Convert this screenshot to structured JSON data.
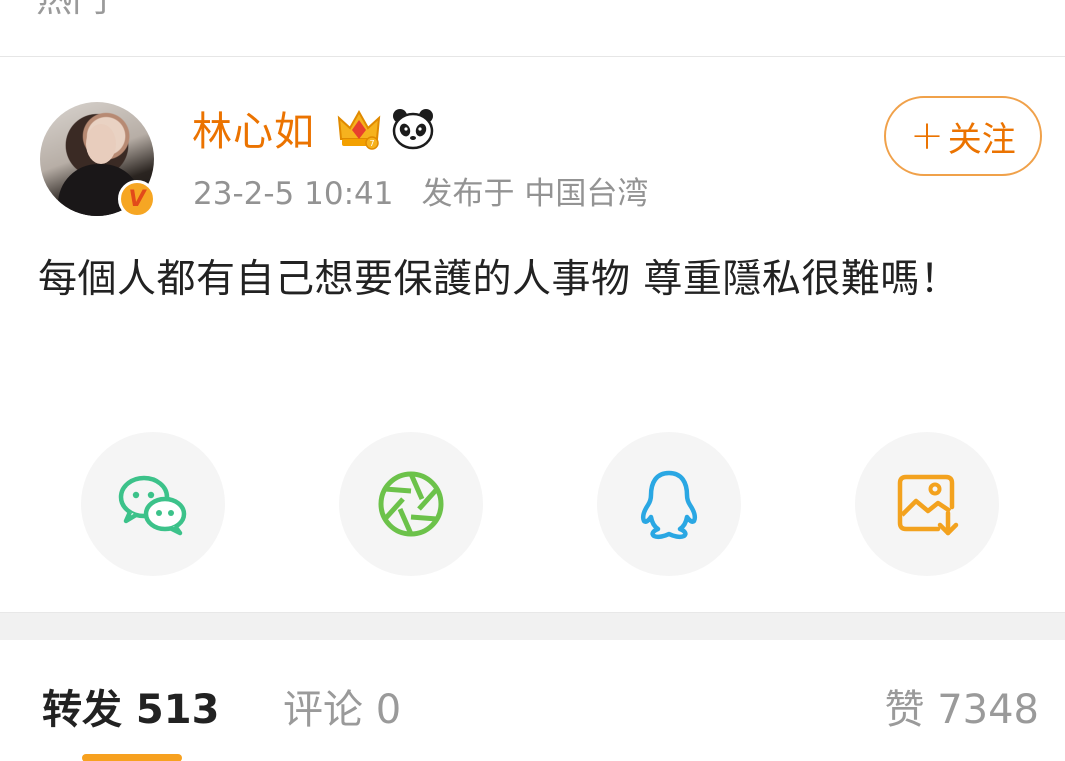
{
  "header": {
    "tab_label": "热门"
  },
  "post": {
    "author": {
      "name": "林心如",
      "badge_letter": "V",
      "icons": [
        "crown-icon",
        "panda-icon"
      ]
    },
    "meta": {
      "time": "23-2-5 10:41",
      "location": "发布于 中国台湾"
    },
    "follow_button": {
      "plus": "+",
      "label": "关注"
    },
    "text": "每個人都有自己想要保護的人事物 尊重隱私很難嗎！"
  },
  "share": {
    "items": [
      {
        "name": "wechat-icon",
        "color": "#3cc28a"
      },
      {
        "name": "moments-icon",
        "color": "#6cc24a"
      },
      {
        "name": "qq-icon",
        "color": "#2aa7e3"
      },
      {
        "name": "save-image-icon",
        "color": "#f3a21e"
      }
    ]
  },
  "tabs": {
    "repost": "转发 513",
    "comment": "评论 0",
    "like": "赞 7348",
    "active": "repost",
    "accent": "#f7a11f"
  },
  "colors": {
    "username": "#eb7300",
    "meta": "#939393",
    "text": "#222222"
  }
}
